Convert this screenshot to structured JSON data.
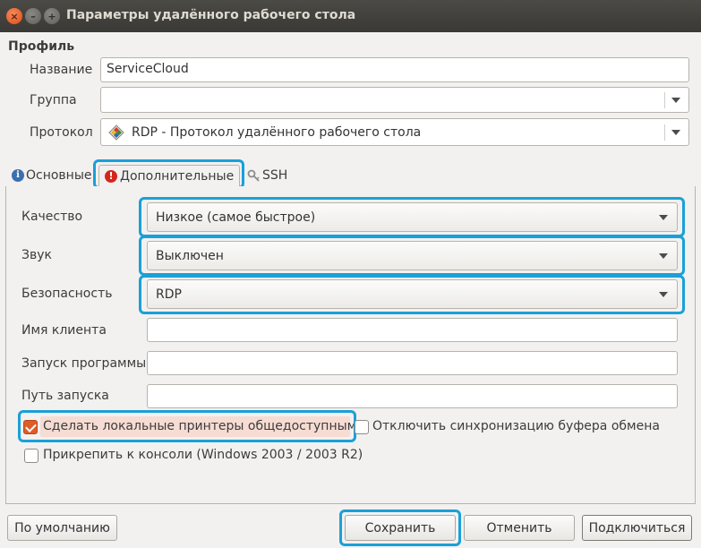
{
  "window": {
    "title": "Параметры удалённого рабочего стола",
    "close_glyph": "×",
    "min_glyph": "–",
    "max_glyph": "+"
  },
  "profile": {
    "section_title": "Профиль",
    "name_label": "Название",
    "name_value": "ServiceCloud",
    "group_label": "Группа",
    "group_value": "",
    "protocol_label": "Протокол",
    "protocol_value": "RDP - Протокол удалённого рабочего стола",
    "protocol_icon": "rdp-plugin-icon"
  },
  "tabs": [
    {
      "label": "Основные",
      "icon": "info-icon",
      "active": false
    },
    {
      "label": "Дополнительные",
      "icon": "warning-icon",
      "active": true
    },
    {
      "label": "SSH",
      "icon": "key-icon",
      "active": false
    }
  ],
  "advanced": {
    "quality_label": "Качество",
    "quality_value": "Низкое (самое быстрое)",
    "sound_label": "Звук",
    "sound_value": "Выключен",
    "security_label": "Безопасность",
    "security_value": "RDP",
    "client_name_label": "Имя клиента",
    "client_name_value": "",
    "startup_program_label": "Запуск программы",
    "startup_program_value": "",
    "startup_path_label": "Путь запуска",
    "startup_path_value": "",
    "share_printers_label": "Сделать локальные принтеры общедоступными",
    "share_printers_checked": true,
    "disable_clipboard_label": "Отключить синхронизацию буфера обмена",
    "disable_clipboard_checked": false,
    "attach_console_label": "Прикрепить к консоли (Windows 2003 / 2003 R2)",
    "attach_console_checked": false
  },
  "buttons": {
    "default": "По умолчанию",
    "save": "Сохранить",
    "cancel": "Отменить",
    "connect": "Подключиться"
  },
  "colors": {
    "highlight": "#1aa0d8",
    "checkbox_accent": "#e05c27",
    "titlebar": "#3c3b37"
  }
}
